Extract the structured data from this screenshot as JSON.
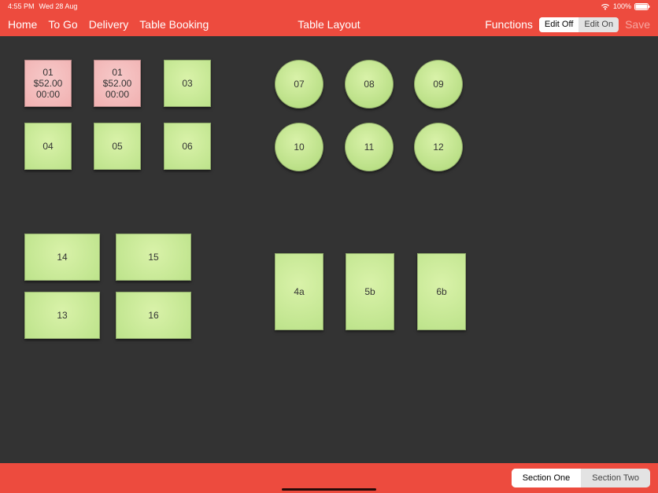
{
  "status": {
    "time": "4:55 PM",
    "date": "Wed 28 Aug",
    "battery": "100%"
  },
  "nav": {
    "home": "Home",
    "togo": "To Go",
    "delivery": "Delivery",
    "booking": "Table Booking"
  },
  "title": "Table Layout",
  "functions": "Functions",
  "edit": {
    "off": "Edit Off",
    "on": "Edit On"
  },
  "save": "Save",
  "tables": {
    "t01a": {
      "id": "01",
      "amount": "$52.00",
      "time": "00:00"
    },
    "t01b": {
      "id": "01",
      "amount": "$52.00",
      "time": "00:00"
    },
    "t03": "03",
    "t04": "04",
    "t05": "05",
    "t06": "06",
    "t07": "07",
    "t08": "08",
    "t09": "09",
    "t10": "10",
    "t11": "11",
    "t12": "12",
    "t14": "14",
    "t15": "15",
    "t13": "13",
    "t16": "16",
    "t4a": "4a",
    "t5b": "5b",
    "t6b": "6b"
  },
  "sections": {
    "one": "Section One",
    "two": "Section Two"
  }
}
